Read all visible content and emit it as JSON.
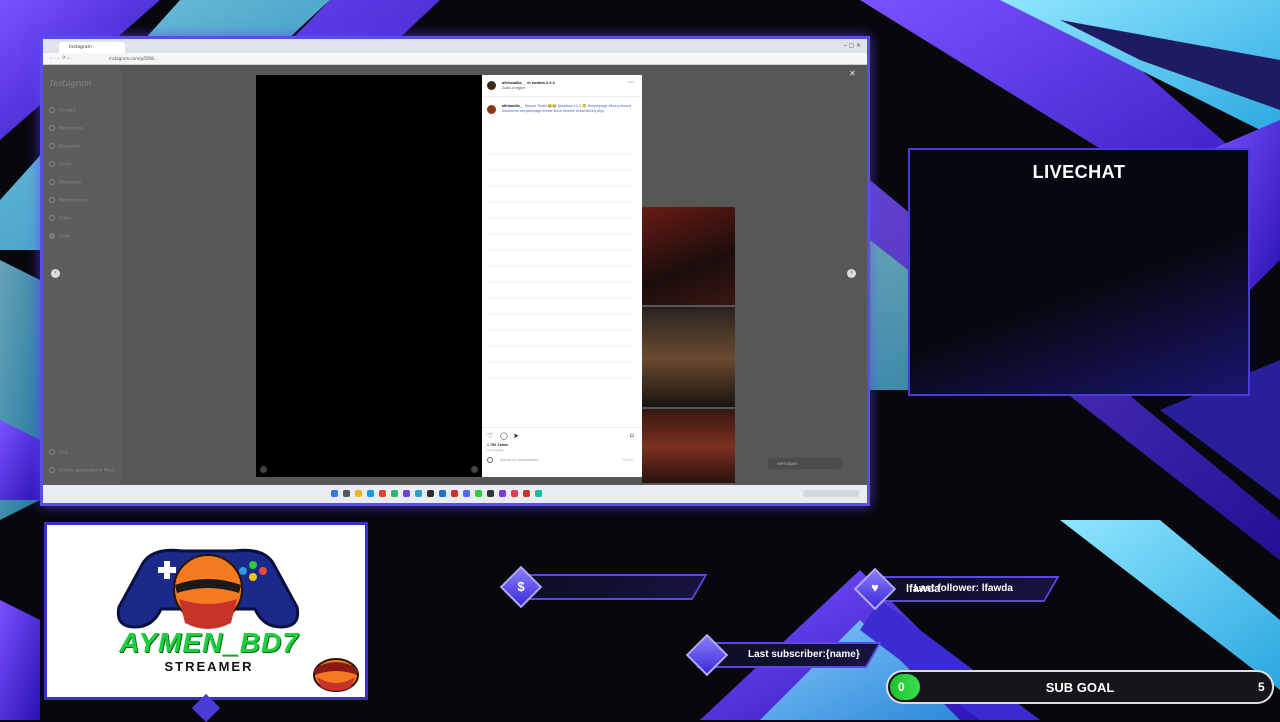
{
  "browser": {
    "tab_title": "Instagram",
    "url": "instagram.com/p/DRW..."
  },
  "instagram": {
    "logo": "Instagram",
    "sidebar": [
      {
        "label": "Accueil",
        "icon": "home-icon"
      },
      {
        "label": "Recherche",
        "icon": "search-icon"
      },
      {
        "label": "Découvrir",
        "icon": "compass-icon"
      },
      {
        "label": "Reels",
        "icon": "reels-icon"
      },
      {
        "label": "Messages",
        "icon": "send-icon"
      },
      {
        "label": "Notifications",
        "icon": "heart-icon"
      },
      {
        "label": "Créer",
        "icon": "plus-icon"
      },
      {
        "label": "Profil",
        "icon": "avatar-icon"
      }
    ],
    "sidebar_bottom": [
      "Plus",
      "Autres applications Meta"
    ],
    "post": {
      "username": "aflriwadlla__ et nadina.3.3.3",
      "subtitle": "Audio d'origine",
      "caption_user": "aflriwadlla__",
      "caption": "Stream Tonite 😂😂 @nadina.3.3.3 🤔 #foryoupage #funny #mood #moments #explorepage #reels #love #meme #viral #funny #fyp",
      "likes": "1 783 J'aime",
      "age": "Il y a 4 jours",
      "comment_placeholder": "Ajouter un commentaire...",
      "publish": "Publier"
    },
    "messages_label": "Messages"
  },
  "overlay": {
    "livechat_title": "LIVECHAT",
    "streamer_name": "AYMEN_BD7",
    "streamer_tag": "STREAMER",
    "donation_icon": "$",
    "follower_name_overlay": "lfawda",
    "last_follower": "Last follower: lfawda",
    "last_subscriber": "Last subscriber:{name}",
    "sub_goal": {
      "label": "SUB GOAL",
      "current": "0",
      "target": "5",
      "progress": 0
    }
  },
  "colors": {
    "accent": "#5b48e6",
    "cyan": "#5ad8f0",
    "green": "#1ed040"
  }
}
